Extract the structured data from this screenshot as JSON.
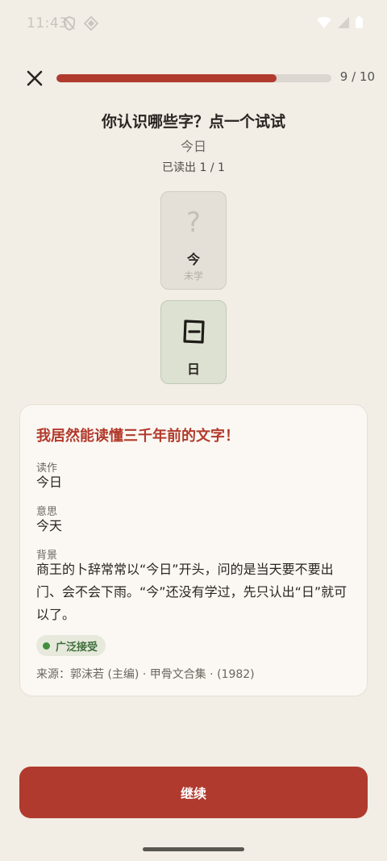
{
  "status": {
    "time": "11:43"
  },
  "header": {
    "progress_text": "9 / 10",
    "progress_fraction": 0.8
  },
  "quiz": {
    "title": "你认识哪些字？点一个试试",
    "word": "今日",
    "read_count": "已读出 1 / 1"
  },
  "cards": [
    {
      "symbol": "?",
      "char": "今",
      "status": "未学"
    },
    {
      "char": "日"
    }
  ],
  "info": {
    "headline": "我居然能读懂三千年前的文字！",
    "reading_label": "读作",
    "reading_value": "今日",
    "meaning_label": "意思",
    "meaning_value": "今天",
    "background_label": "背景",
    "background_value": "商王的卜辞常常以“今日”开头，问的是当天要不要出门、会不会下雨。“今”还没有学过，先只认出“日”就可以了。",
    "badge": "广泛接受",
    "source": "来源：郭沫若 (主编) · 甲骨文合集 · (1982)"
  },
  "footer": {
    "continue_label": "继续"
  },
  "colors": {
    "accent": "#b03a2e",
    "badge_green": "#3f8f3c"
  }
}
